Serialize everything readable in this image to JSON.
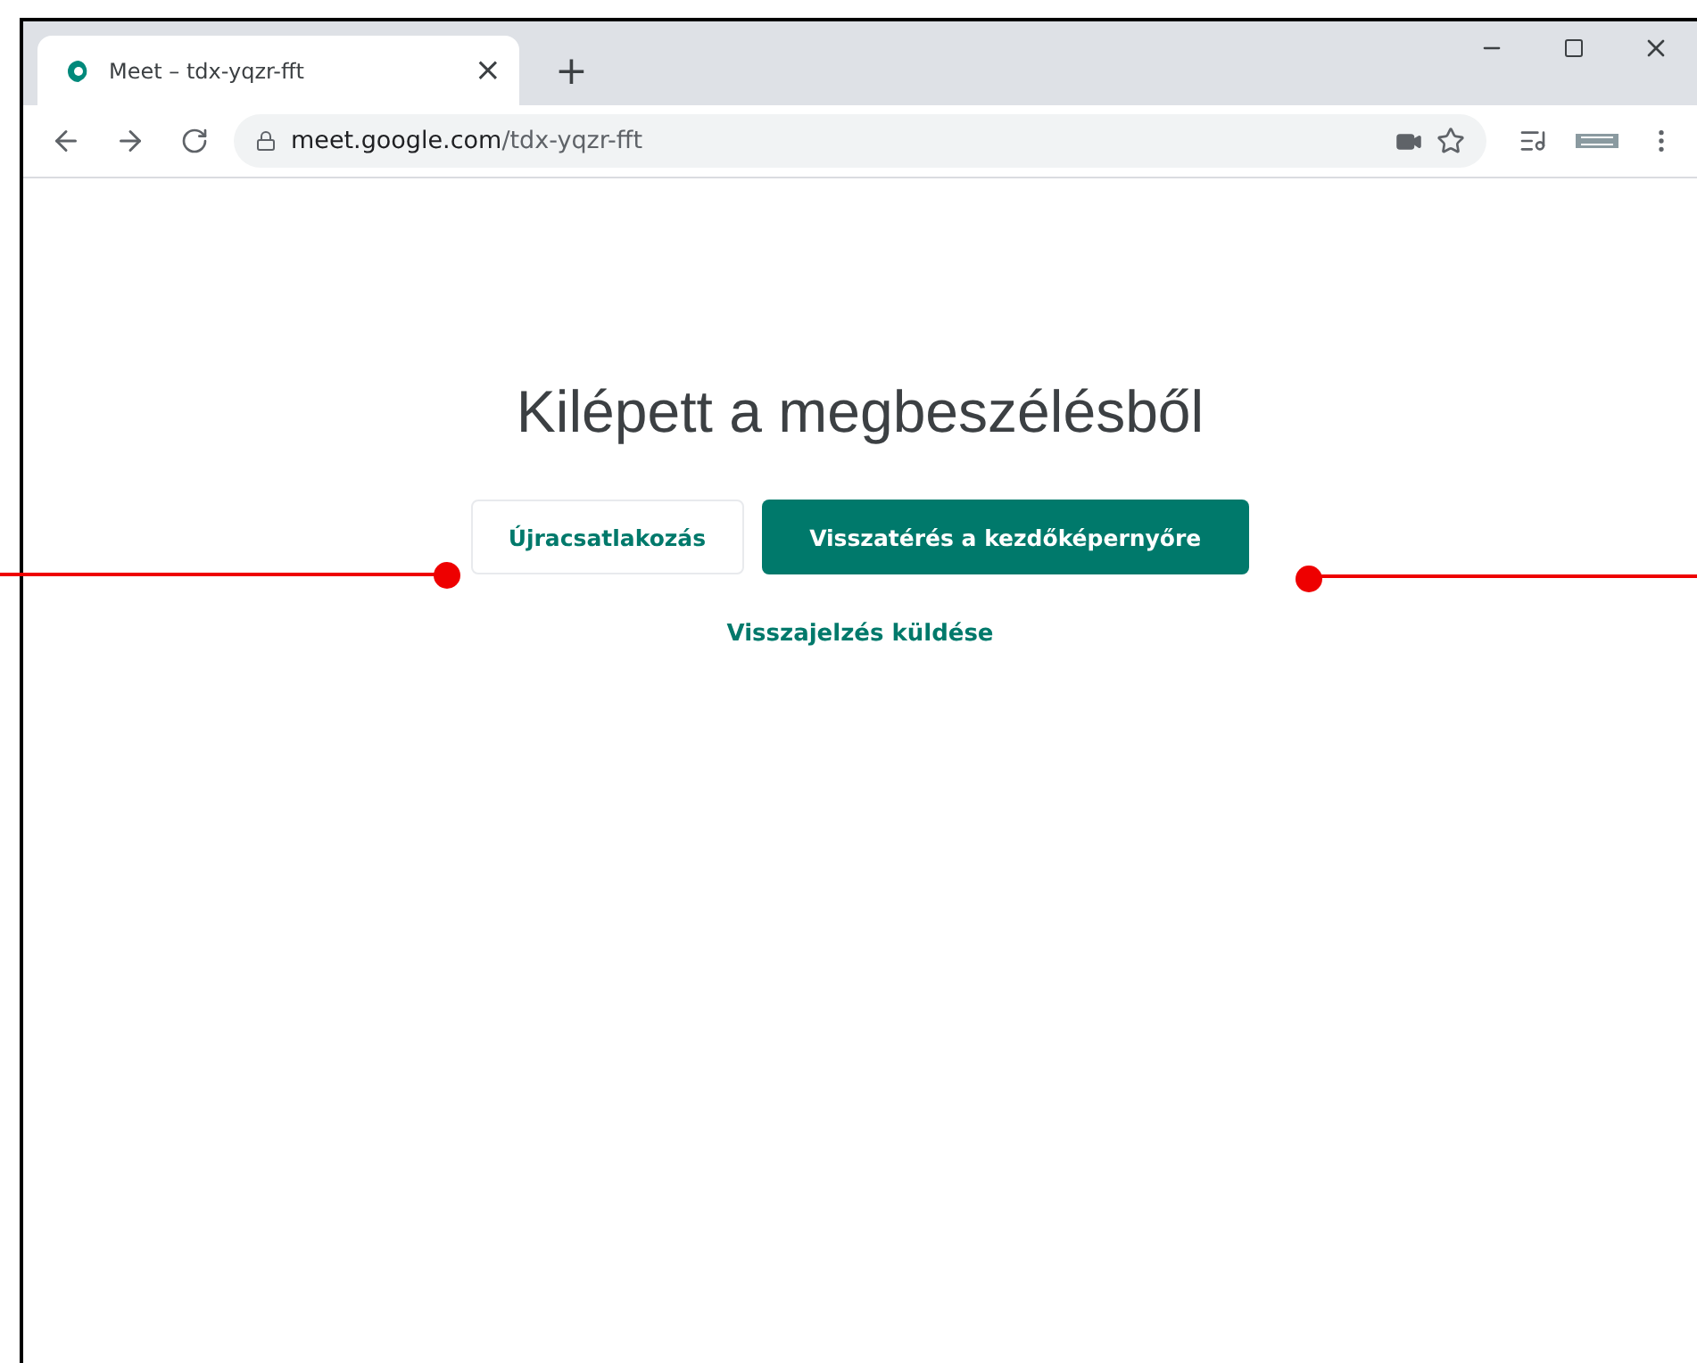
{
  "tab": {
    "title": "Meet – tdx-yqzr-fft",
    "close": "×",
    "new_tab": "+"
  },
  "address_bar": {
    "host": "meet.google.com",
    "path": "/tdx-yqzr-fft"
  },
  "page": {
    "heading": "Kilépett a megbeszélésből",
    "buttons": [
      {
        "label": "Újracsatlakozás",
        "kind": "outlined"
      },
      {
        "label": "Visszatérés a kezdőképernyőre",
        "kind": "filled"
      }
    ],
    "link": "Visszajelzés küldése"
  }
}
